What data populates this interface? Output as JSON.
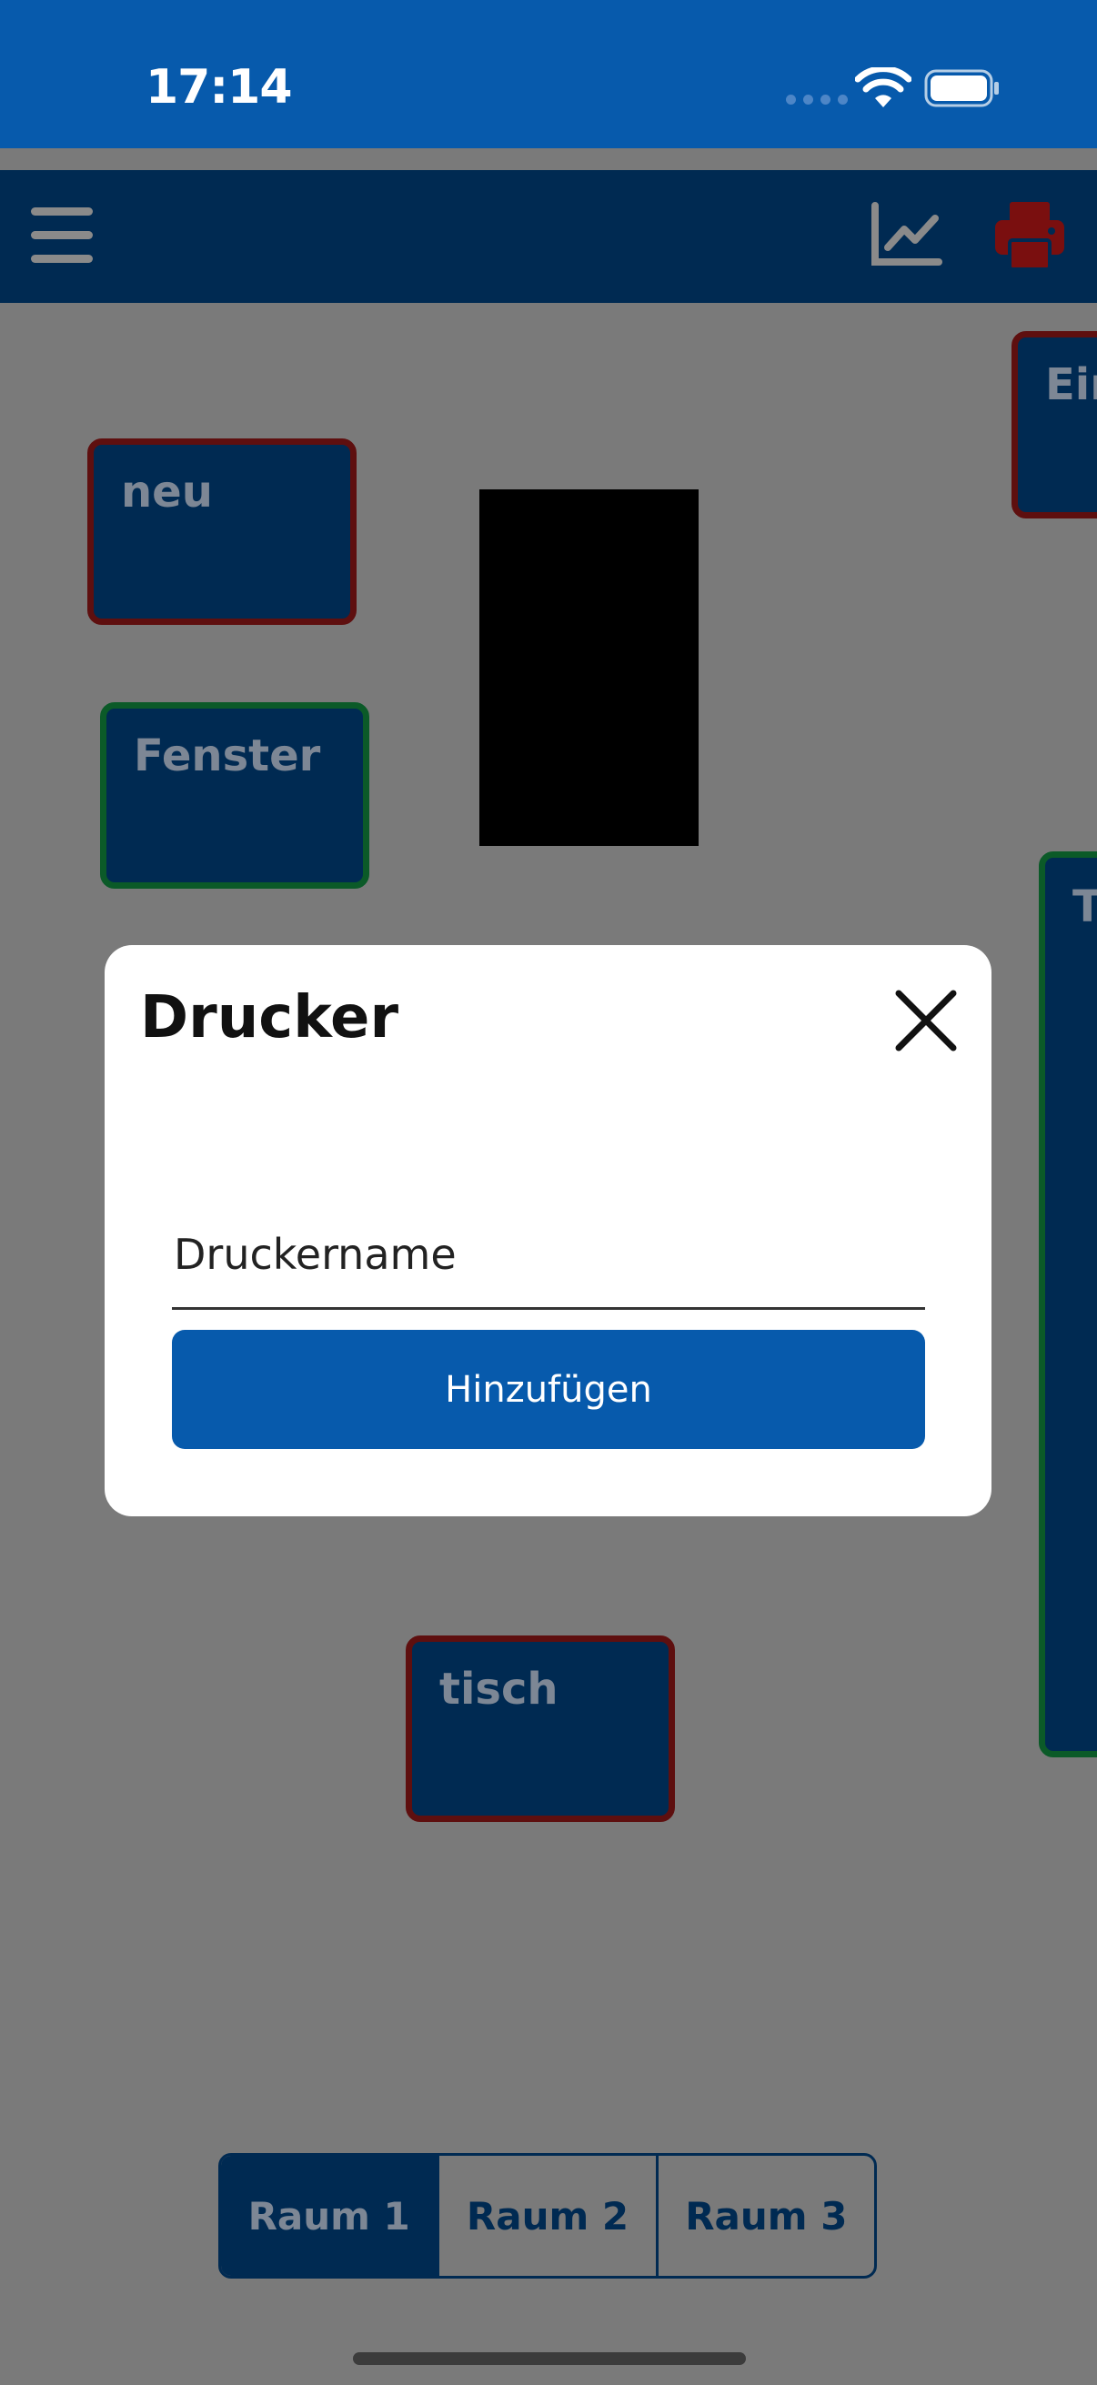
{
  "status_bar": {
    "time": "17:14"
  },
  "canvas": {
    "tiles": {
      "neu": "neu",
      "fenster": "Fenster",
      "ein": "Ein",
      "t": "T",
      "tisch": "tisch"
    }
  },
  "dialog": {
    "title": "Drucker",
    "input_placeholder": "Druckername",
    "input_value": "",
    "add_button": "Hinzufügen"
  },
  "rooms": {
    "items": [
      "Raum 1",
      "Raum 2",
      "Raum 3"
    ],
    "active": "Raum 1"
  },
  "colors": {
    "status_bar": "#075aac",
    "app_bar": "#002a52",
    "overlay": "#7a7a7a",
    "tile_border_red": "#5e0f0f",
    "tile_border_green": "#0b5a28",
    "printer_icon": "#7a0f0f"
  },
  "icons": [
    "menu-icon",
    "chart-icon",
    "printer-icon",
    "close-icon",
    "wifi-icon",
    "battery-icon",
    "signal-icon"
  ]
}
